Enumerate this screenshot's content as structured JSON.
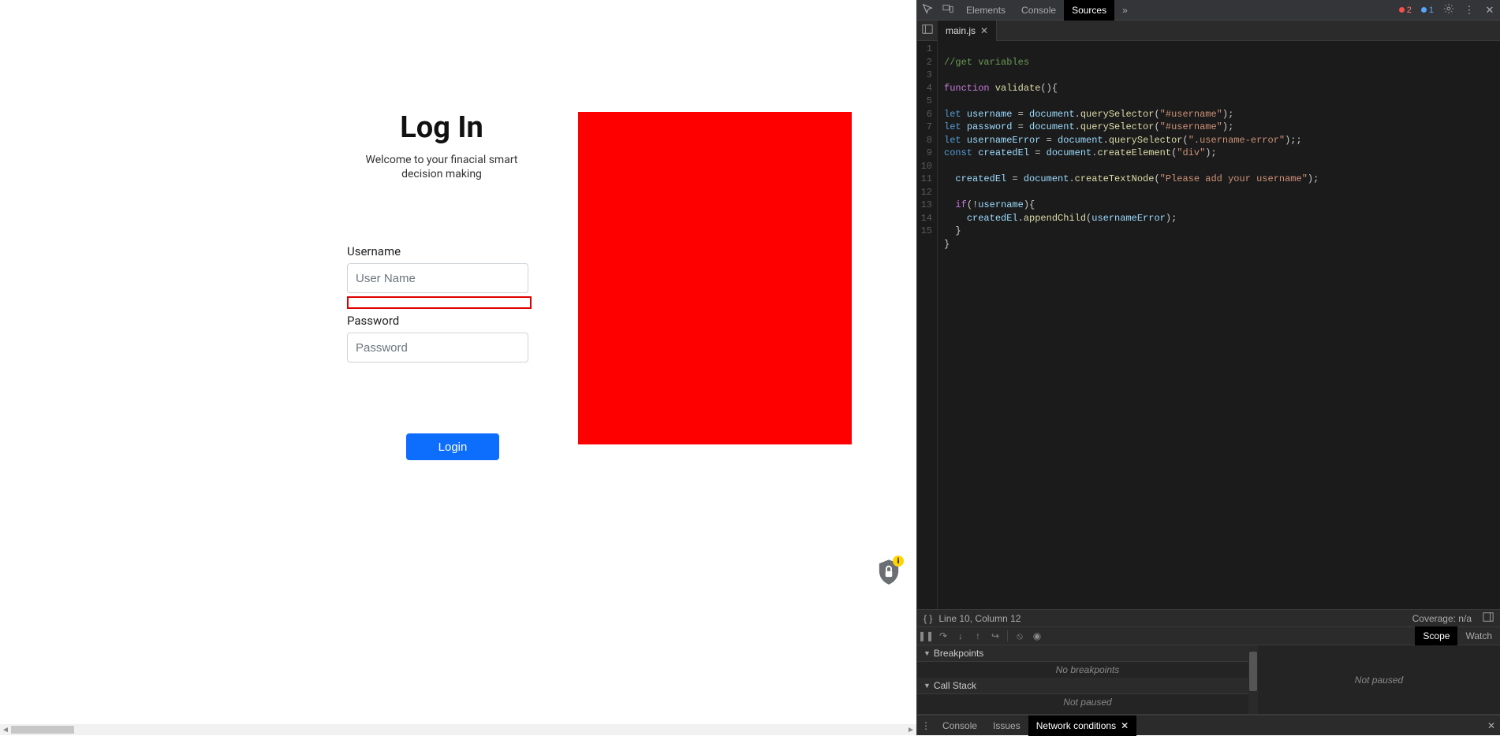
{
  "page": {
    "title": "Log In",
    "subtitle": "Welcome to your finacial smart decision making",
    "username_label": "Username",
    "username_placeholder": "User Name",
    "password_label": "Password",
    "password_placeholder": "Password",
    "login_button": "Login",
    "shield_badge": "i"
  },
  "devtools": {
    "top_tabs": {
      "elements": "Elements",
      "console": "Console",
      "sources": "Sources",
      "more": "»"
    },
    "error_count": "2",
    "info_count": "1",
    "file_tab": "main.js",
    "status": {
      "position": "Line 10, Column 12",
      "coverage": "Coverage: n/a"
    },
    "debug_tabs": {
      "scope": "Scope",
      "watch": "Watch"
    },
    "breakpoints": {
      "header": "Breakpoints",
      "body": "No breakpoints"
    },
    "callstack": {
      "header": "Call Stack",
      "body": "Not paused"
    },
    "right_panel_msg": "Not paused",
    "drawer": {
      "console": "Console",
      "issues": "Issues",
      "network_conditions": "Network conditions"
    },
    "code": {
      "lines": [
        "1",
        "2",
        "3",
        "4",
        "5",
        "6",
        "7",
        "8",
        "9",
        "10",
        "11",
        "12",
        "13",
        "14",
        "15"
      ],
      "l1": "//get variables",
      "l3_kw": "function",
      "l3_name": " validate",
      "l3_rest": "(){",
      "l5_let": "let ",
      "l5_id": "username",
      "l5_eq": " = ",
      "l5_doc": "document",
      "l5_dot": ".",
      "l5_fn": "querySelector",
      "l5_p1": "(",
      "l5_str": "\"#username\"",
      "l5_p2": ");",
      "l6_let": "let ",
      "l6_id": "password",
      "l6_eq": " = ",
      "l6_doc": "document",
      "l6_dot": ".",
      "l6_fn": "querySelector",
      "l6_p1": "(",
      "l6_str": "\"#username\"",
      "l6_p2": ");",
      "l7_let": "let ",
      "l7_id": "usernameError",
      "l7_eq": " = ",
      "l7_doc": "document",
      "l7_dot": ".",
      "l7_fn": "querySelector",
      "l7_p1": "(",
      "l7_str": "\".username-error\"",
      "l7_p2": ");;",
      "l8_const": "const ",
      "l8_id": "createdEl",
      "l8_eq": " = ",
      "l8_doc": "document",
      "l8_dot": ".",
      "l8_fn": "createElement",
      "l8_p1": "(",
      "l8_str": "\"div\"",
      "l8_p2": ");",
      "l10_sp": "  ",
      "l10_id": "createdEl",
      "l10_eq": " = ",
      "l10_doc": "document",
      "l10_dot": ".",
      "l10_fn": "createTextNode",
      "l10_p1": "(",
      "l10_str": "\"Please add your username\"",
      "l10_p2": ");",
      "l12_sp": "  ",
      "l12_if": "if",
      "l12_p1": "(!",
      "l12_id": "username",
      "l12_p2": "){",
      "l13_sp": "    ",
      "l13_id": "createdEl",
      "l13_dot": ".",
      "l13_fn": "appendChild",
      "l13_p1": "(",
      "l13_arg": "usernameError",
      "l13_p2": ");",
      "l14": "  }",
      "l15": "}"
    }
  }
}
